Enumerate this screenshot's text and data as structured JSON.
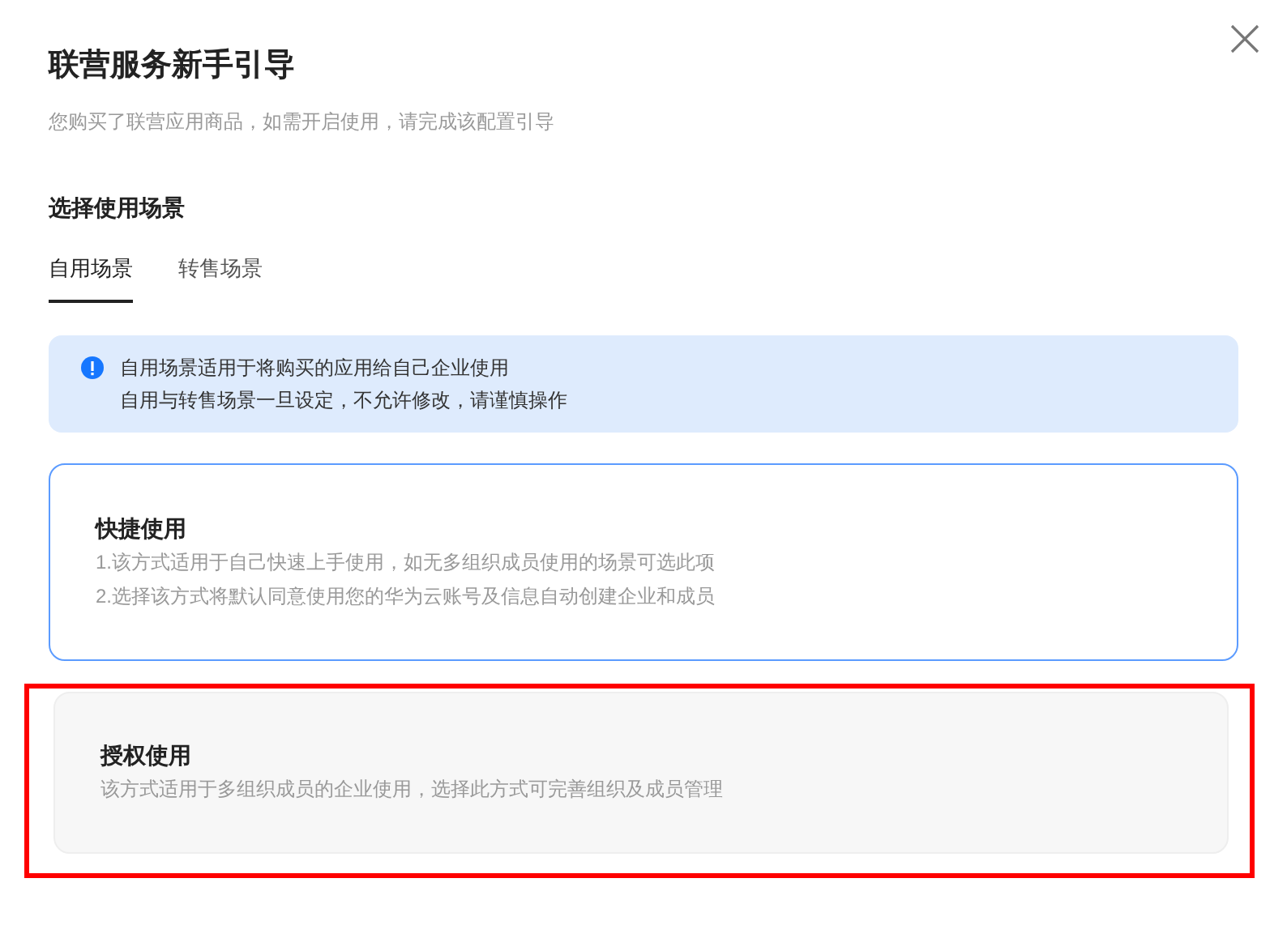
{
  "dialog": {
    "title": "联营服务新手引导",
    "subtitle": "您购买了联营应用商品，如需开启使用，请完成该配置引导"
  },
  "section_title": "选择使用场景",
  "tabs": [
    {
      "label": "自用场景",
      "selected": true
    },
    {
      "label": "转售场景",
      "selected": false
    }
  ],
  "info": {
    "lines": [
      "自用场景适用于将购买的应用给自己企业使用",
      "自用与转售场景一旦设定，不允许修改，请谨慎操作"
    ]
  },
  "options": [
    {
      "title": "快捷使用",
      "lines": [
        "1.该方式适用于自己快速上手使用，如无多组织成员使用的场景可选此项",
        "2.选择该方式将默认同意使用您的华为云账号及信息自动创建企业和成员"
      ],
      "selected": true,
      "highlighted": false
    },
    {
      "title": "授权使用",
      "lines": [
        "该方式适用于多组织成员的企业使用，选择此方式可完善组织及成员管理"
      ],
      "selected": false,
      "highlighted": true
    }
  ]
}
